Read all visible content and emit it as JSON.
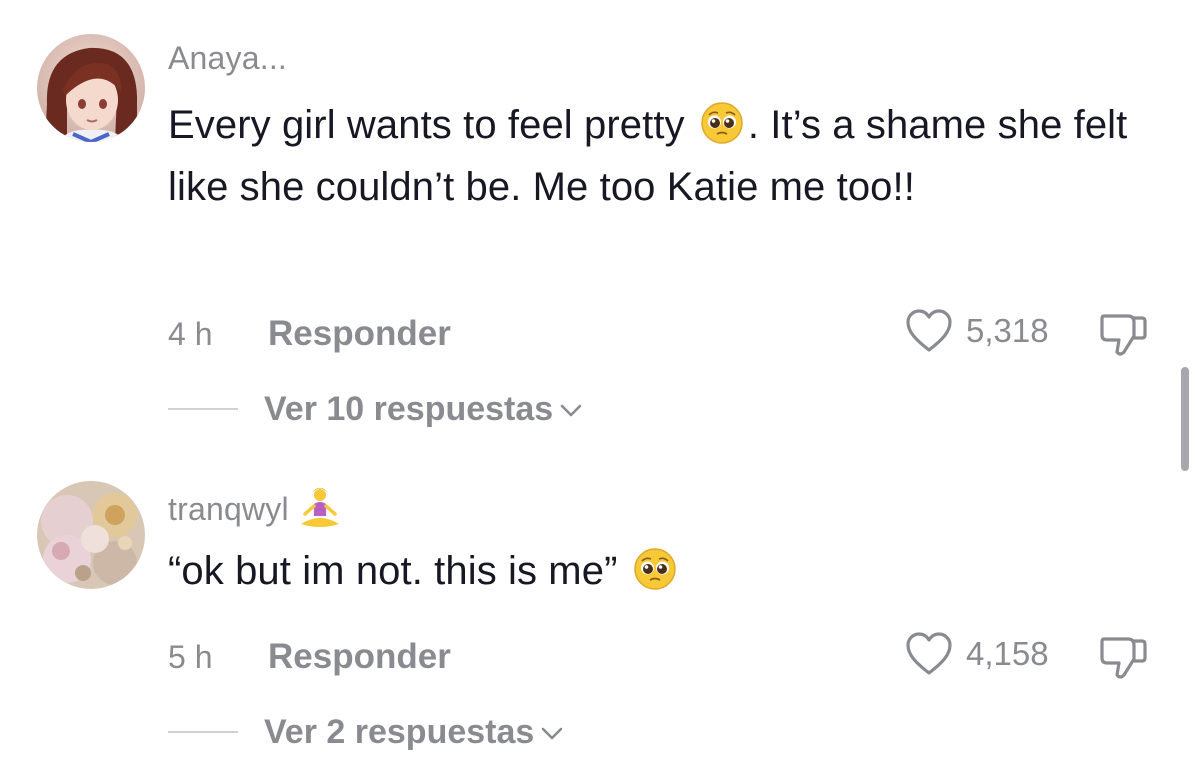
{
  "comments": [
    {
      "username": "Anaya...",
      "text_before_emoji": "Every girl wants to feel pretty ",
      "text_after_emoji": ". It’s a shame she felt like she couldn’t be. Me too Katie me too!!",
      "emoji": "pleading-face-emoji",
      "time": "4 h",
      "reply_label": "Responder",
      "likes": "5,318",
      "view_replies": "Ver 10 respuestas"
    },
    {
      "username": "tranqwyl",
      "username_emoji": "woman-in-lotus-position-emoji",
      "text": "“ok but im not. this is me” ",
      "emoji": "pleading-face-emoji",
      "time": "5 h",
      "reply_label": "Responder",
      "likes": "4,158",
      "view_replies": "Ver 2 respuestas"
    }
  ],
  "colors": {
    "primary_text": "#161823",
    "secondary_text": "#8a8b91",
    "divider": "#d0d1d3",
    "scrollbar": "#a7a8ad"
  },
  "icons": [
    "heart-outline-icon",
    "thumbs-down-icon",
    "chevron-down-icon"
  ]
}
